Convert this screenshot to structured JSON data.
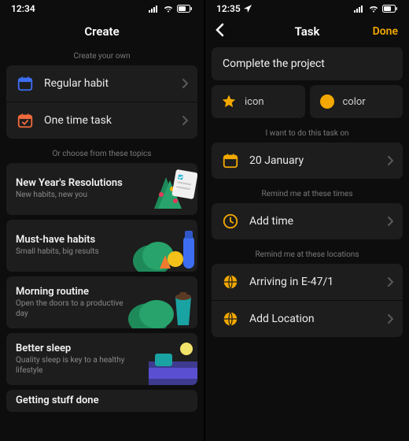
{
  "left": {
    "status_time": "12:34",
    "title": "Create",
    "caption_own": "Create your own",
    "habit_label": "Regular habit",
    "onetime_label": "One time task",
    "caption_topics": "Or choose from these topics",
    "topics": [
      {
        "title": "New Year's Resolutions",
        "sub": "New habits, new you"
      },
      {
        "title": "Must-have habits",
        "sub": "Small habits, big results"
      },
      {
        "title": "Morning routine",
        "sub": "Open the doors to a productive day"
      },
      {
        "title": "Better sleep",
        "sub": "Quality sleep is key to a healthy lifestyle"
      },
      {
        "title": "Getting stuff done",
        "sub": ""
      }
    ]
  },
  "right": {
    "status_time": "12:35",
    "title": "Task",
    "done": "Done",
    "task_name": "Complete the project",
    "icon_label": "icon",
    "color_label": "color",
    "caption_date": "I want to do this task on",
    "date_label": "20 January",
    "caption_time": "Remind me at these times",
    "add_time": "Add time",
    "caption_loc": "Remind me at these locations",
    "loc1": "Arriving in E-47/1",
    "loc2": "Add Location"
  },
  "colors": {
    "accent_blue": "#3d6ef2",
    "accent_orange": "#f06a3d",
    "accent_yellow": "#f2a800"
  }
}
